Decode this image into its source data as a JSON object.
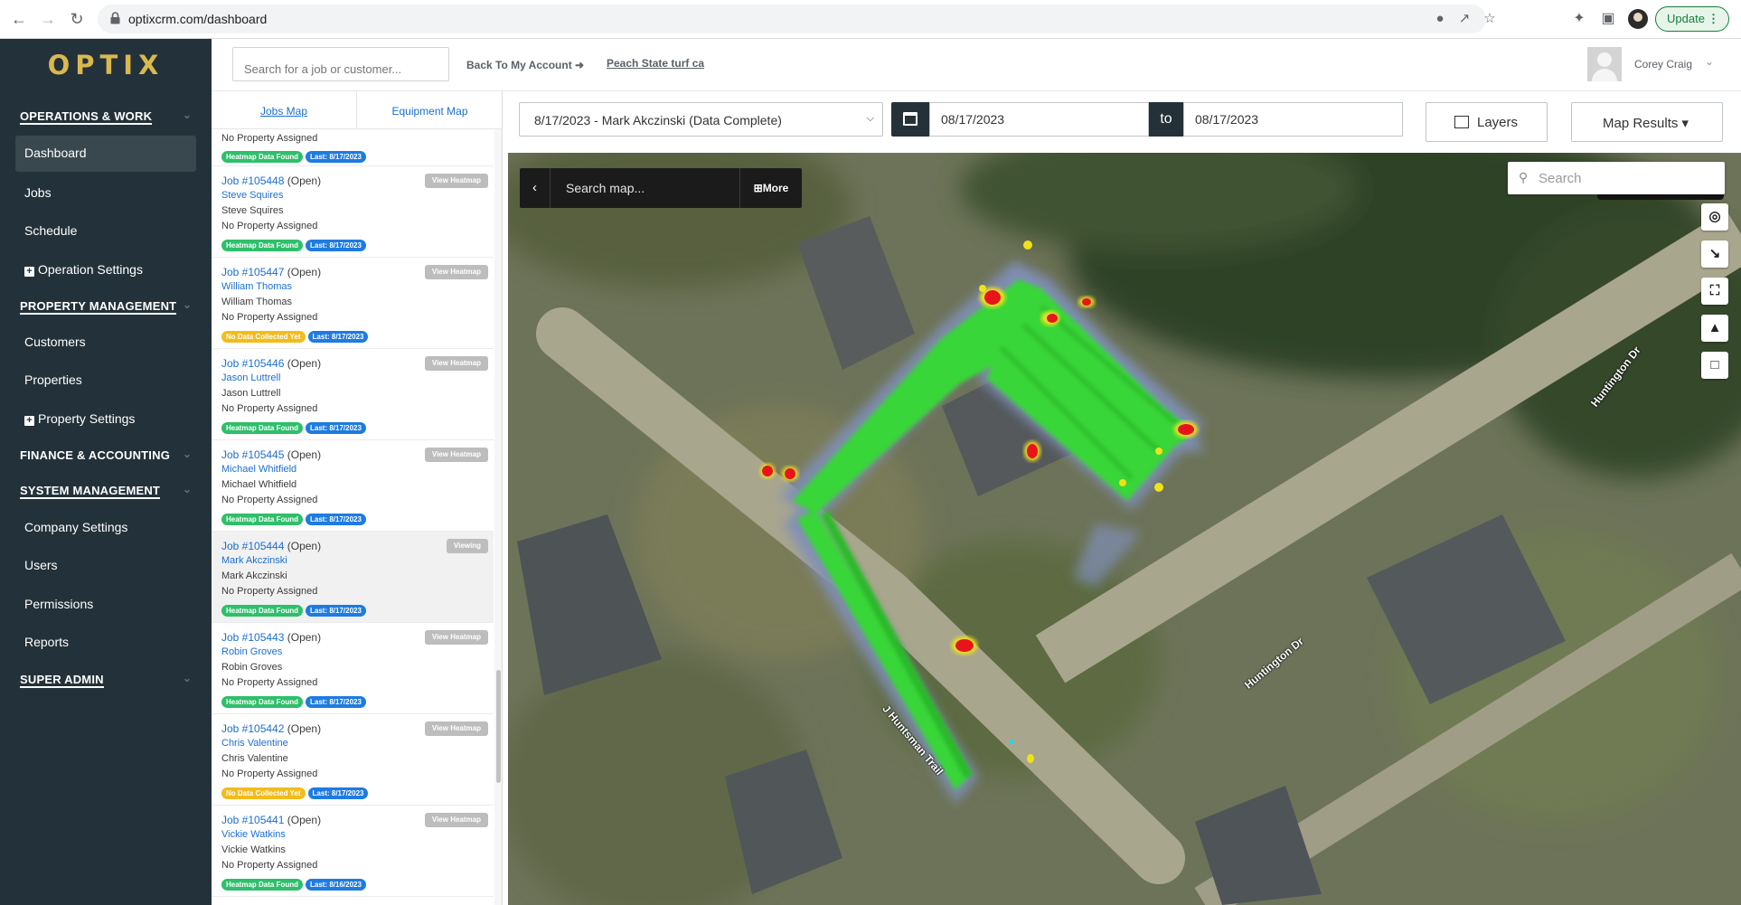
{
  "browser": {
    "url": "optixcrm.com/dashboard",
    "update_label": "Update"
  },
  "sidebar": {
    "logo": "OPTIX",
    "sections": [
      {
        "label": "OPERATIONS & WORK"
      },
      {
        "label": "PROPERTY MANAGEMENT"
      },
      {
        "label": "FINANCE & ACCOUNTING"
      },
      {
        "label": "SYSTEM MANAGEMENT"
      },
      {
        "label": "SUPER ADMIN"
      }
    ],
    "items": {
      "dashboard": "Dashboard",
      "jobs": "Jobs",
      "schedule": "Schedule",
      "operation_settings": "Operation Settings",
      "customers": "Customers",
      "properties": "Properties",
      "property_settings": "Property Settings",
      "company_settings": "Company Settings",
      "users": "Users",
      "permissions": "Permissions",
      "reports": "Reports"
    }
  },
  "topbar": {
    "search_placeholder": "Search for a job or customer...",
    "back_link": "Back To My Account",
    "company": "Peach State turf ca",
    "user_name": "Corey Craig"
  },
  "panel": {
    "tabs": [
      "Jobs Map",
      "Equipment Map"
    ],
    "first_partial": {
      "property": "No Property Assigned",
      "badge_status": "Heatmap Data Found",
      "badge_last": "Last: 8/17/2023"
    },
    "jobs": [
      {
        "title": "Job #105448",
        "status": "(Open)",
        "client_link": "Steve Squires",
        "client": "Steve Squires",
        "property": "No Property Assigned",
        "badge_status": "Heatmap Data Found",
        "badge_status_color": "green",
        "badge_last": "Last: 8/17/2023",
        "action": "View Heatmap"
      },
      {
        "title": "Job #105447",
        "status": "(Open)",
        "client_link": "William Thomas",
        "client": "William Thomas",
        "property": "No Property Assigned",
        "badge_status": "No Data Collected Yet",
        "badge_status_color": "yellow",
        "badge_last": "Last: 8/17/2023",
        "action": "View Heatmap"
      },
      {
        "title": "Job #105446",
        "status": "(Open)",
        "client_link": "Jason Luttrell",
        "client": "Jason Luttrell",
        "property": "No Property Assigned",
        "badge_status": "Heatmap Data Found",
        "badge_status_color": "green",
        "badge_last": "Last: 8/17/2023",
        "action": "View Heatmap"
      },
      {
        "title": "Job #105445",
        "status": "(Open)",
        "client_link": "Michael Whitfield",
        "client": "Michael Whitfield",
        "property": "No Property Assigned",
        "badge_status": "Heatmap Data Found",
        "badge_status_color": "green",
        "badge_last": "Last: 8/17/2023",
        "action": "View Heatmap"
      },
      {
        "title": "Job #105444",
        "status": "(Open)",
        "client_link": "Mark Akczinski",
        "client": "Mark Akczinski",
        "property": "No Property Assigned",
        "badge_status": "Heatmap Data Found",
        "badge_status_color": "green",
        "badge_last": "Last: 8/17/2023",
        "action": "Viewing"
      },
      {
        "title": "Job #105443",
        "status": "(Open)",
        "client_link": "Robin Groves",
        "client": "Robin Groves",
        "property": "No Property Assigned",
        "badge_status": "Heatmap Data Found",
        "badge_status_color": "green",
        "badge_last": "Last: 8/17/2023",
        "action": "View Heatmap"
      },
      {
        "title": "Job #105442",
        "status": "(Open)",
        "client_link": "Chris Valentine",
        "client": "Chris Valentine",
        "property": "No Property Assigned",
        "badge_status": "No Data Collected Yet",
        "badge_status_color": "yellow",
        "badge_last": "Last: 8/17/2023",
        "action": "View Heatmap"
      },
      {
        "title": "Job #105441",
        "status": "(Open)",
        "client_link": "Vickie Watkins",
        "client": "Vickie Watkins",
        "property": "No Property Assigned",
        "badge_status": "Heatmap Data Found",
        "badge_status_color": "green",
        "badge_last": "Last: 8/16/2023",
        "action": "View Heatmap"
      }
    ]
  },
  "filters": {
    "job_select": "8/17/2023 - Mark Akczinski (Data Complete)",
    "date_from": "08/17/2023",
    "to_label": "to",
    "date_to": "08/17/2023",
    "layers_label": "Layers",
    "results_label": "Map Results"
  },
  "map": {
    "search_placeholder": "Search map...",
    "more_label": "More",
    "search2_placeholder": "Search",
    "streets": [
      "Huntington Dr",
      "Huntington Dr",
      "J Huntsman Trail"
    ],
    "colors": {
      "coverage": "#39d639",
      "hotspot": "#e8141a",
      "warm": "#f0e21a",
      "halo": "#7f8fb8"
    }
  }
}
